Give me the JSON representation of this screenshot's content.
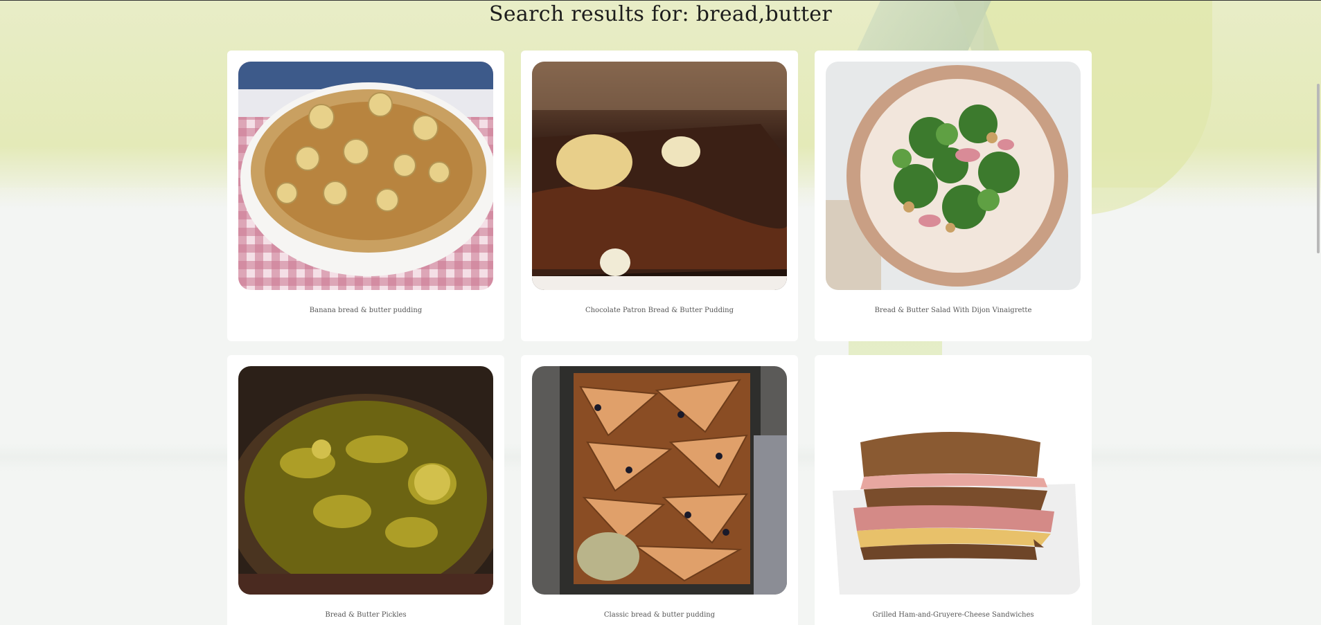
{
  "search": {
    "title": "Search results for: bread,butter"
  },
  "results": [
    {
      "name": "Banana bread & butter pudding",
      "image_icon": "banana-pudding-photo"
    },
    {
      "name": "Chocolate Patron Bread & Butter Pudding",
      "image_icon": "chocolate-pudding-photo"
    },
    {
      "name": "Bread & Butter Salad With Dijon Vinaigrette",
      "image_icon": "salad-bowl-photo"
    },
    {
      "name": "Bread & Butter Pickles",
      "image_icon": "pickles-photo"
    },
    {
      "name": "Classic bread & butter pudding",
      "image_icon": "baked-pudding-tray-photo"
    },
    {
      "name": "Grilled Ham-and-Gruyere-Cheese Sandwiches",
      "image_icon": "grilled-sandwich-photo"
    }
  ],
  "colors": {
    "background_wash": "#e4eab8",
    "card": "#ffffff",
    "title_text": "#1c1c1c",
    "caption_text": "#555555"
  }
}
